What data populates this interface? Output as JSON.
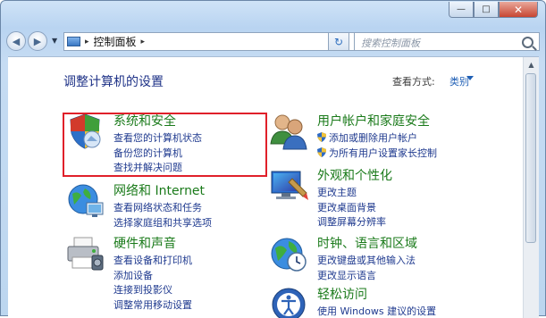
{
  "window": {
    "controls": {
      "minimize": "—",
      "maximize": "□",
      "close": "✕"
    }
  },
  "navbar": {
    "address": {
      "icon": "control-panel-icon",
      "separator": "▸",
      "text": "控制面板",
      "trailing_separator": "▸"
    },
    "search": {
      "placeholder": "搜索控制面板"
    }
  },
  "main": {
    "title": "调整计算机的设置",
    "view_by": {
      "label": "查看方式:",
      "value": "类别"
    }
  },
  "categories": [
    {
      "id": "system-security",
      "title": "系统和安全",
      "icon": "shield-icon",
      "links": [
        {
          "label": "查看您的计算机状态"
        },
        {
          "label": "备份您的计算机"
        },
        {
          "label": "查找并解决问题"
        }
      ]
    },
    {
      "id": "user-accounts",
      "title": "用户帐户和家庭安全",
      "icon": "users-icon",
      "links": [
        {
          "label": "添加或删除用户帐户",
          "shield": true
        },
        {
          "label": "为所有用户设置家长控制",
          "shield": true
        }
      ]
    },
    {
      "id": "network",
      "title": "网络和 Internet",
      "icon": "network-icon",
      "links": [
        {
          "label": "查看网络状态和任务"
        },
        {
          "label": "选择家庭组和共享选项"
        }
      ]
    },
    {
      "id": "appearance",
      "title": "外观和个性化",
      "icon": "appearance-icon",
      "links": [
        {
          "label": "更改主题"
        },
        {
          "label": "更改桌面背景"
        },
        {
          "label": "调整屏幕分辨率"
        }
      ]
    },
    {
      "id": "hardware",
      "title": "硬件和声音",
      "icon": "printer-icon",
      "links": [
        {
          "label": "查看设备和打印机"
        },
        {
          "label": "添加设备"
        },
        {
          "label": "连接到投影仪"
        },
        {
          "label": "调整常用移动设置"
        }
      ]
    },
    {
      "id": "clock",
      "title": "时钟、语言和区域",
      "icon": "globe-clock-icon",
      "links": [
        {
          "label": "更改键盘或其他输入法",
          "shield": false
        },
        {
          "label": "更改显示语言"
        }
      ]
    },
    {
      "id": "ease",
      "title": "轻松访问",
      "icon": "ease-of-access-icon",
      "links": [
        {
          "label": "使用 Windows 建议的设置"
        }
      ]
    }
  ],
  "colors": {
    "category_title": "#1a7a1a",
    "link": "#1f3a8f",
    "page_title": "#1e3287",
    "highlight_border": "#e0202a"
  }
}
